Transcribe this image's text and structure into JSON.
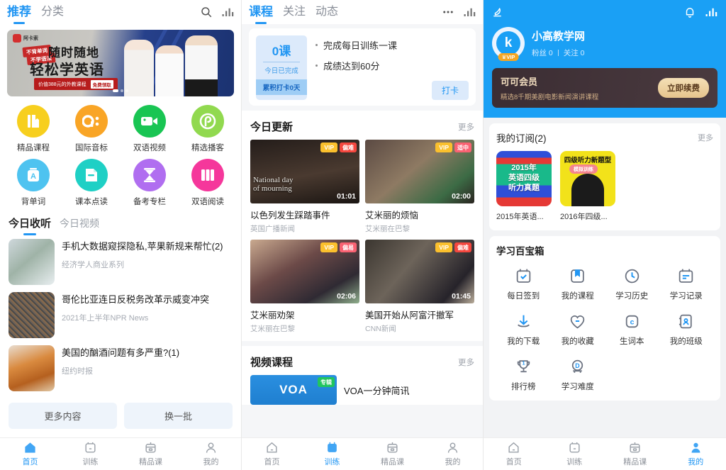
{
  "screen1": {
    "topbar": {
      "tabs": [
        {
          "label": "推荐",
          "active": true
        },
        {
          "label": "分类",
          "active": false
        }
      ],
      "search_icon": "search-icon",
      "recorder_icon": "screen-recorder-icon"
    },
    "banner": {
      "brand": "阿卡索",
      "ribbon1": "不背单词",
      "ribbon2": "不学语法",
      "headline1": "随时随地",
      "headline2": "轻松学英语",
      "sub_text": "价值388元的外教课程",
      "sub_badge": "免费领取"
    },
    "grid": [
      {
        "label": "精品课程",
        "icon": "book-icon",
        "color": "#f7cf1e"
      },
      {
        "label": "国际音标",
        "icon": "phonetic-icon",
        "color": "#f9a526"
      },
      {
        "label": "双语视频",
        "icon": "video-camera-icon",
        "color": "#19c553"
      },
      {
        "label": "精选播客",
        "icon": "podcast-icon",
        "color": "#91d94f"
      },
      {
        "label": "背单词",
        "icon": "word-card-icon",
        "color": "#4ec3f0"
      },
      {
        "label": "课本点读",
        "icon": "textbook-icon",
        "color": "#1fd0c5"
      },
      {
        "label": "备考专栏",
        "icon": "hourglass-icon",
        "color": "#b06ef0"
      },
      {
        "label": "双语阅读",
        "icon": "books-icon",
        "color": "#f5379b"
      }
    ],
    "subtabs": [
      {
        "label": "今日收听",
        "active": true
      },
      {
        "label": "今日视频",
        "active": false
      }
    ],
    "articles": [
      {
        "title": "手机大数据窥探隐私,苹果新规来帮忙(2)",
        "source": "经济学人商业系列",
        "thumb": "news-interview-photo"
      },
      {
        "title": "哥伦比亚连日反税务改革示威变冲突",
        "source": "2021年上半年NPR News",
        "thumb": "protest-crowd-photo"
      },
      {
        "title": "美国的酗酒问题有多严重?(1)",
        "source": "纽约时报",
        "thumb": "beer-cheers-photo"
      }
    ],
    "buttons": [
      "更多内容",
      "换一批"
    ],
    "bottom_nav": [
      {
        "label": "首页",
        "icon": "home-icon",
        "active": true
      },
      {
        "label": "训练",
        "icon": "training-icon",
        "active": false
      },
      {
        "label": "精品课",
        "icon": "course-icon",
        "active": false
      },
      {
        "label": "我的",
        "icon": "profile-icon",
        "active": false
      }
    ]
  },
  "screen2": {
    "topbar": {
      "tabs": [
        {
          "label": "课程",
          "active": true
        },
        {
          "label": "关注",
          "active": false
        },
        {
          "label": "动态",
          "active": false
        }
      ],
      "more_icon": "more-dots-icon",
      "recorder_icon": "screen-recorder-icon"
    },
    "checkin": {
      "count": "0课",
      "count_label": "今日已完成",
      "streak": "累积打卡0天",
      "tasks": [
        "完成每日训练一课",
        "成绩达到60分"
      ],
      "button": "打卡"
    },
    "today_update": {
      "title": "今日更新",
      "more": "更多",
      "videos": [
        {
          "title": "以色列发生踩踏事件",
          "source": "英国广播新闻",
          "duration": "01:01",
          "vip": "VIP",
          "difficulty": "偏难",
          "difficulty_color": "#f4473f",
          "caption": "National day\nof mourning",
          "thumb": "night-crowd-photo"
        },
        {
          "title": "艾米丽的烦恼",
          "source": "艾米丽在巴黎",
          "duration": "02:00",
          "vip": "VIP",
          "difficulty": "适中",
          "difficulty_color": "#f96272",
          "caption": "",
          "thumb": "emily-green-top-photo"
        },
        {
          "title": "艾米丽劝架",
          "source": "艾米丽在巴黎",
          "duration": "02:06",
          "vip": "VIP",
          "difficulty": "偏易",
          "difficulty_color": "#f96272",
          "caption": "",
          "thumb": "emily-portrait-photo"
        },
        {
          "title": "美国开始从阿富汗撤军",
          "source": "CNN新闻",
          "duration": "01:45",
          "vip": "VIP",
          "difficulty": "偏难",
          "difficulty_color": "#f4473f",
          "caption": "",
          "thumb": "officials-car-photo"
        }
      ]
    },
    "video_course": {
      "title": "视频课程",
      "more": "更多",
      "items": [
        {
          "title": "VOA一分钟简讯",
          "thumb_text": "VOA",
          "badge": "专辑"
        }
      ]
    },
    "bottom_nav": [
      {
        "label": "首页",
        "icon": "home-icon",
        "active": false
      },
      {
        "label": "训练",
        "icon": "training-icon",
        "active": true
      },
      {
        "label": "精品课",
        "icon": "course-icon",
        "active": false
      },
      {
        "label": "我的",
        "icon": "profile-icon",
        "active": false
      }
    ]
  },
  "screen3": {
    "topbar": {
      "night_icon": "night-mode-icon",
      "bell_icon": "notification-bell-icon",
      "recorder_icon": "screen-recorder-icon"
    },
    "profile": {
      "avatar_letter": "k",
      "vip_badge": "VIP",
      "name": "小高教学网",
      "fans_label": "粉丝 0",
      "follow_label": "关注 0"
    },
    "vip_banner": {
      "title": "可可会员",
      "subtitle": "精选8千期美剧电影新闻演讲课程",
      "button": "立即续费"
    },
    "subscriptions": {
      "title": "我的订阅(2)",
      "more": "更多",
      "items": [
        {
          "name": "2015年英语...",
          "cover_title": "2015年\n英语四级\n听力真题",
          "cover": "cef-listening-cover"
        },
        {
          "name": "2016年四级...",
          "cover_title": "四级听力新题型",
          "cover": "cet4-listening-cover"
        }
      ]
    },
    "toolbox": {
      "title": "学习百宝箱",
      "items": [
        {
          "label": "每日签到",
          "icon": "calendar-check-icon"
        },
        {
          "label": "我的课程",
          "icon": "bookmark-box-icon"
        },
        {
          "label": "学习历史",
          "icon": "clock-icon"
        },
        {
          "label": "学习记录",
          "icon": "calendar-lines-icon"
        },
        {
          "label": "我的下载",
          "icon": "download-icon"
        },
        {
          "label": "我的收藏",
          "icon": "heart-icon"
        },
        {
          "label": "生词本",
          "icon": "letter-c-icon"
        },
        {
          "label": "我的班级",
          "icon": "class-person-icon"
        },
        {
          "label": "排行榜",
          "icon": "trophy-icon"
        },
        {
          "label": "学习难度",
          "icon": "difficulty-icon"
        }
      ]
    },
    "bottom_nav": [
      {
        "label": "首页",
        "icon": "home-icon",
        "active": false
      },
      {
        "label": "训练",
        "icon": "training-icon",
        "active": false
      },
      {
        "label": "精品课",
        "icon": "course-icon",
        "active": false
      },
      {
        "label": "我的",
        "icon": "profile-icon",
        "active": true
      }
    ]
  },
  "theme": {
    "accent": "#2196f3",
    "header_blue": "#1aa0f5",
    "gold": "#f5a623",
    "vip_yellow": "#fbc02d",
    "muted": "#a0a5ad"
  }
}
